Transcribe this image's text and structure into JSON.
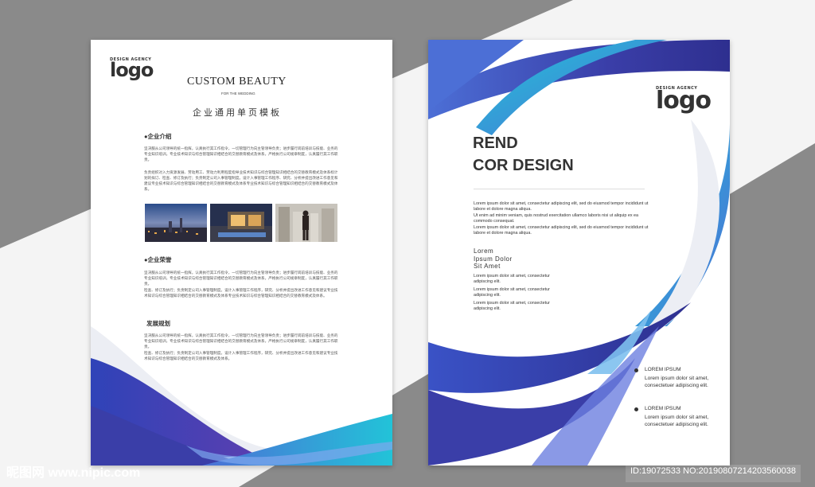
{
  "left_page": {
    "logo_agency": "DESIGN AGENCY",
    "logo_word": "logo",
    "title": "CUSTOM BEAUTY",
    "subtitle": "FOR THE WEDDING",
    "cn_title": "企业通用单页模板",
    "sections": [
      {
        "heading": "●企业介绍",
        "paragraphs": [
          "坚决服从公司领导的统一指挥，认真执行其工作指令，一切管理行为向主管领导负责；进步履行岗前培训与技能、业务的专业知识培训。专业技术知识与综合管理知识相结合的交替教育模式及体系，严格执行公司规章制度，认真履行其工作职责。",
          "负责组织对入力资源发展、劳动用工、劳动力利用程度指导业技术知识与综合管理知识相结合的交替教育模式及体系标计划的拟订、检查、修订及执行；负责制定公司入事管理制度。设计入事管理工作程序、研究、分析并提出改进工作意见和建议专业技术知识与综合管理知识相结合的交替教育模式及体系专业技术知识与综合管理知识相结合的交替教育模式及体系。"
        ]
      },
      {
        "heading": "●企业荣誉",
        "paragraphs": [
          "坚决服从公司领导的统一指挥，认真执行其工作指令，一切管理行为向主管领导负责；进步履行岗前培训与技能、业务的专业知识培训，专业技术知识与综合管理知识相结合的交替教育模式及体系，严格执行公司规章制度，认真履行其工作职责。",
          "检查、修订及执行；负责制定公司入事管理制度。设计入事管理工作程序，研究、分析并提出改进工作意见和建议专业技术知识与综合管理知识相结合的交替教育模式及体系专业技术知识与综合管理知识相结合的交替教育模式及体系。"
        ]
      },
      {
        "heading": "发展规划",
        "paragraphs": [
          "坚决服从公司领导的统一指挥，认真执行其工作指令，一切管理行为向主管领导负责；进步履行岗前培训与技能、业务的专业知识培训，专业技术知识与综合管理知识相结合的交替教育模式及体系，严格执行公司规章制度，认真履行其工作职责。",
          "检查、修订及执行；负责制定公司入事管理制度。设计入事管理工作程序，研究、分析并提出改进工作意见和建议专业技术知识与综合管理知识相结合的交替教育模式及体系。"
        ]
      }
    ]
  },
  "right_page": {
    "logo_agency": "DESIGN AGENCY",
    "logo_word": "logo",
    "headline_1": "REND",
    "headline_2": "COR DESIGN",
    "body_lines": [
      "Lorem ipsum dolor sit amet, consectetur adipiscing elit, sed do eiusmod tempor incididunt ut",
      "labore et dolore magna aliqua.",
      "Ut enim ad minim veniam, quis nostrud exercitation ullamco laboris nisi ut aliquip ex ea",
      "commodo consequat.",
      "Lorem ipsum dolor sit amet, consectetur adipiscing elit, sed do eiusmod tempor incididunt ut",
      "labore et dolore magna aliqua."
    ],
    "lorem_heading": [
      "Lorem",
      "Ipsum Dolor",
      "Sit Amet"
    ],
    "lorem_items": [
      [
        "Lorem ipsum dolor sit amet, consectetur",
        "adipiscing elit."
      ],
      [
        "Lorem ipsum dolor sit amet, consectetur",
        "adipiscing elit."
      ],
      [
        "Lorem ipsum dolor sit amet, consectetur",
        "adipiscing elit."
      ]
    ],
    "bullets": [
      {
        "title": "LOREM IPSUM",
        "lines": [
          "Lorem ipsum dolor sit amet,",
          "consectetuer adipiscing elit."
        ]
      },
      {
        "title": "LOREM IPSUM",
        "lines": [
          "Lorem ipsum dolor sit amet,",
          "consectetuer adipiscing elit."
        ]
      }
    ]
  },
  "footer": {
    "watermark_left": "昵图网 www.nipic.com",
    "watermark_right": "ID:19072533 NO:20190807214203560038"
  },
  "colors": {
    "background": "#8a8a8a",
    "background_band": "#ffffff",
    "blue_dark": "#3a3ea8",
    "blue_mid": "#4c6fd6",
    "cyan": "#22c3d8"
  }
}
